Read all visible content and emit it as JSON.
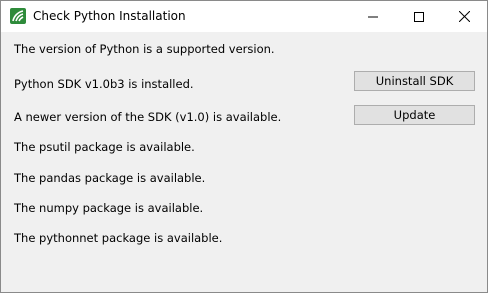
{
  "window": {
    "title": "Check Python Installation",
    "minimize_glyph": "—",
    "maximize_glyph": "☐",
    "close_glyph": "✕"
  },
  "messages": [
    "The version of Python is a supported version.",
    "Python SDK v1.0b3 is installed.",
    "A newer version of the SDK (v1.0) is available.",
    "The psutil package is available.",
    "The pandas package is available.",
    "The numpy package is available.",
    "The pythonnet package is available."
  ],
  "buttons": {
    "uninstall_label": "Uninstall SDK",
    "update_label": "Update"
  },
  "icons": {
    "app": "app-logo-icon"
  },
  "colors": {
    "app_icon": "#2e8b3a",
    "button_bg": "#e1e1e1",
    "button_border": "#adadad",
    "window_bg": "#f0f0f0"
  }
}
